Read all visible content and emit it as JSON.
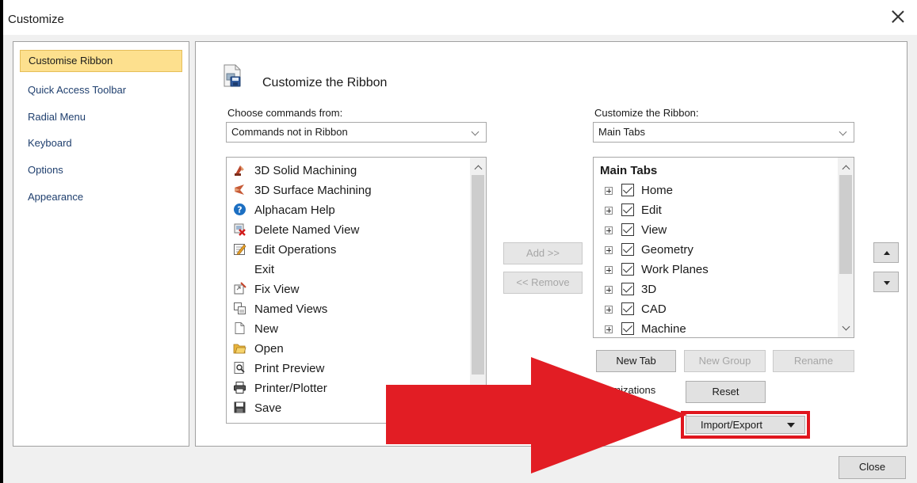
{
  "window": {
    "title": "Customize"
  },
  "nav": {
    "items": [
      {
        "label": "Customise Ribbon",
        "selected": true
      },
      {
        "label": "Quick Access Toolbar"
      },
      {
        "label": "Radial Menu"
      },
      {
        "label": "Keyboard"
      },
      {
        "label": "Options"
      },
      {
        "label": "Appearance"
      }
    ]
  },
  "main": {
    "header": "Customize the Ribbon"
  },
  "left_panel": {
    "label": "Choose commands from:",
    "combo_value": "Commands not in Ribbon",
    "commands": [
      {
        "label": "3D Solid Machining",
        "icon": "3d-solid-machining-icon"
      },
      {
        "label": "3D Surface Machining",
        "icon": "3d-surface-machining-icon"
      },
      {
        "label": "Alphacam Help",
        "icon": "help-icon"
      },
      {
        "label": "Delete Named View",
        "icon": "delete-named-view-icon"
      },
      {
        "label": "Edit Operations",
        "icon": "edit-operations-icon"
      },
      {
        "label": "Exit",
        "icon": ""
      },
      {
        "label": "Fix View",
        "icon": "fix-view-icon"
      },
      {
        "label": "Named Views",
        "icon": "named-views-icon"
      },
      {
        "label": "New",
        "icon": "new-document-icon"
      },
      {
        "label": "Open",
        "icon": "open-folder-icon"
      },
      {
        "label": "Print Preview",
        "icon": "print-preview-icon"
      },
      {
        "label": "Printer/Plotter",
        "icon": "printer-icon"
      },
      {
        "label": "Save",
        "icon": "save-icon"
      }
    ]
  },
  "middle": {
    "add_label": "Add >>",
    "remove_label": "<< Remove"
  },
  "right_panel": {
    "label": "Customize the Ribbon:",
    "combo_value": "Main Tabs",
    "tree_header": "Main Tabs",
    "tabs": [
      {
        "label": "Home",
        "checked": true
      },
      {
        "label": "Edit",
        "checked": true
      },
      {
        "label": "View",
        "checked": true
      },
      {
        "label": "Geometry",
        "checked": true
      },
      {
        "label": "Work Planes",
        "checked": true
      },
      {
        "label": "3D",
        "checked": true
      },
      {
        "label": "CAD",
        "checked": true
      },
      {
        "label": "Machine",
        "checked": true
      }
    ],
    "new_tab_label": "New Tab",
    "new_group_label": "New Group",
    "rename_label": "Rename",
    "customizations_label": "stomizations",
    "reset_label": "Reset",
    "import_export_label": "Import/Export"
  },
  "footer": {
    "close_label": "Close"
  },
  "colors": {
    "selected_nav": "#fde08e",
    "highlight": "#e0161e"
  }
}
